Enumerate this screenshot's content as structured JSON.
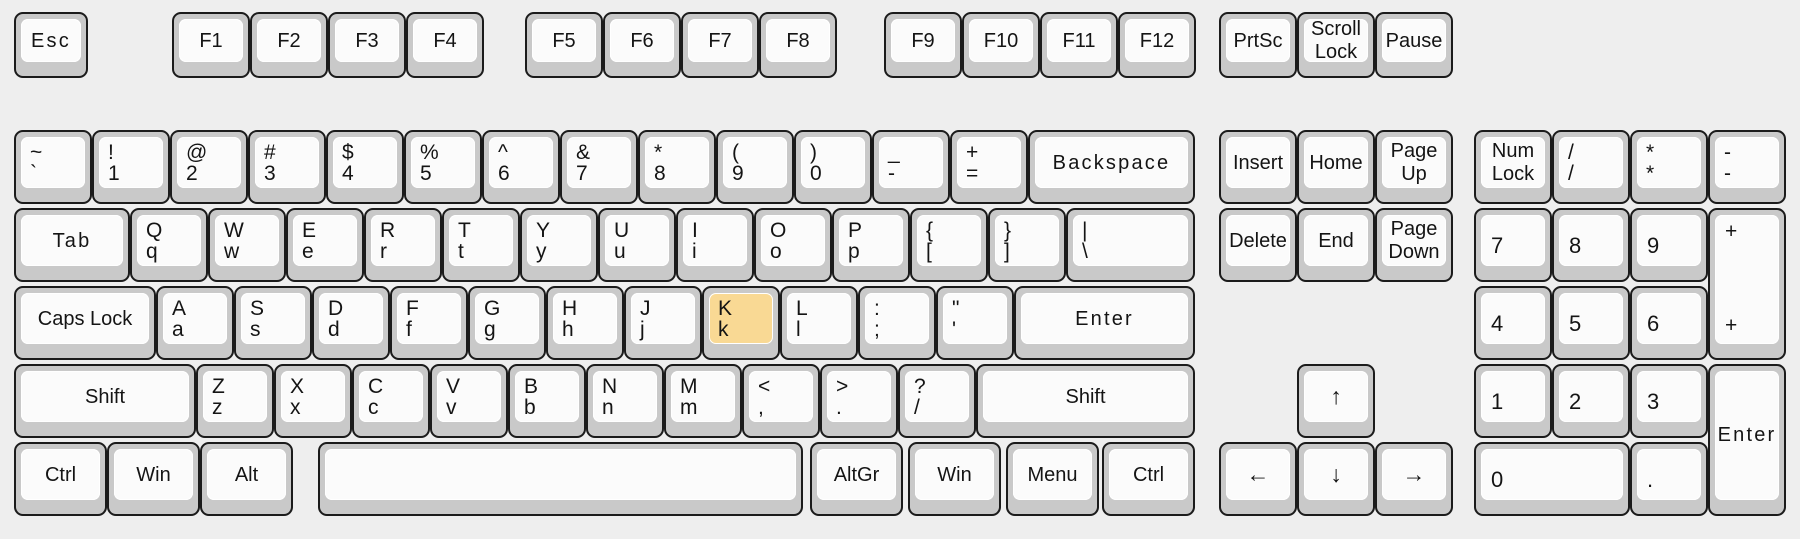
{
  "meta": {
    "title": "Keyboard Layout Diagram",
    "highlight_color": "#f9d994",
    "key_face_color": "#fbfbfb",
    "key_body_color": "#c9c9c9",
    "background_color": "#eeeeee",
    "highlighted_keys": [
      "K"
    ]
  },
  "function_row": {
    "esc": {
      "label": "Esc"
    },
    "group1": [
      {
        "label": "F1"
      },
      {
        "label": "F2"
      },
      {
        "label": "F3"
      },
      {
        "label": "F4"
      }
    ],
    "group2": [
      {
        "label": "F5"
      },
      {
        "label": "F6"
      },
      {
        "label": "F7"
      },
      {
        "label": "F8"
      }
    ],
    "group3": [
      {
        "label": "F9"
      },
      {
        "label": "F10"
      },
      {
        "label": "F11"
      },
      {
        "label": "F12"
      }
    ],
    "group4": [
      {
        "label": "PrtSc"
      },
      {
        "line1": "Scroll",
        "line2": "Lock"
      },
      {
        "label": "Pause"
      }
    ]
  },
  "main_rows": {
    "row_digits": [
      {
        "top": "~",
        "bottom": "`"
      },
      {
        "top": "!",
        "bottom": "1"
      },
      {
        "top": "@",
        "bottom": "2"
      },
      {
        "top": "#",
        "bottom": "3"
      },
      {
        "top": "$",
        "bottom": "4"
      },
      {
        "top": "%",
        "bottom": "5"
      },
      {
        "top": "^",
        "bottom": "6"
      },
      {
        "top": "&",
        "bottom": "7"
      },
      {
        "top": "*",
        "bottom": "8"
      },
      {
        "top": "(",
        "bottom": "9"
      },
      {
        "top": ")",
        "bottom": "0"
      },
      {
        "top": "_",
        "bottom": "-"
      },
      {
        "top": "+",
        "bottom": "="
      },
      {
        "label": "Backspace"
      }
    ],
    "row_qwerty": [
      {
        "label": "Tab"
      },
      {
        "top": "Q",
        "bottom": "q"
      },
      {
        "top": "W",
        "bottom": "w"
      },
      {
        "top": "E",
        "bottom": "e"
      },
      {
        "top": "R",
        "bottom": "r"
      },
      {
        "top": "T",
        "bottom": "t"
      },
      {
        "top": "Y",
        "bottom": "y"
      },
      {
        "top": "U",
        "bottom": "u"
      },
      {
        "top": "I",
        "bottom": "i"
      },
      {
        "top": "O",
        "bottom": "o"
      },
      {
        "top": "P",
        "bottom": "p"
      },
      {
        "top": "{",
        "bottom": "["
      },
      {
        "top": "}",
        "bottom": "]"
      },
      {
        "top": "|",
        "bottom": "\\"
      }
    ],
    "row_asdf": [
      {
        "label": "Caps Lock"
      },
      {
        "top": "A",
        "bottom": "a"
      },
      {
        "top": "S",
        "bottom": "s"
      },
      {
        "top": "D",
        "bottom": "d"
      },
      {
        "top": "F",
        "bottom": "f"
      },
      {
        "top": "G",
        "bottom": "g"
      },
      {
        "top": "H",
        "bottom": "h"
      },
      {
        "top": "J",
        "bottom": "j"
      },
      {
        "top": "K",
        "bottom": "k",
        "highlight": true
      },
      {
        "top": "L",
        "bottom": "l"
      },
      {
        "top": ":",
        "bottom": ";"
      },
      {
        "top": "\"",
        "bottom": "'"
      },
      {
        "label": "Enter"
      }
    ],
    "row_zxcv": [
      {
        "label": "Shift"
      },
      {
        "top": "Z",
        "bottom": "z"
      },
      {
        "top": "X",
        "bottom": "x"
      },
      {
        "top": "C",
        "bottom": "c"
      },
      {
        "top": "V",
        "bottom": "v"
      },
      {
        "top": "B",
        "bottom": "b"
      },
      {
        "top": "N",
        "bottom": "n"
      },
      {
        "top": "M",
        "bottom": "m"
      },
      {
        "top": "<",
        "bottom": ","
      },
      {
        "top": ">",
        "bottom": "."
      },
      {
        "top": "?",
        "bottom": "/"
      },
      {
        "label": "Shift"
      }
    ],
    "row_bottom": [
      {
        "label": "Ctrl"
      },
      {
        "label": "Win"
      },
      {
        "label": "Alt"
      },
      {
        "label": ""
      },
      {
        "label": "AltGr"
      },
      {
        "label": "Win"
      },
      {
        "label": "Menu"
      },
      {
        "label": "Ctrl"
      }
    ]
  },
  "nav_cluster": {
    "row1": [
      {
        "label": "Insert"
      },
      {
        "label": "Home"
      },
      {
        "line1": "Page",
        "line2": "Up"
      }
    ],
    "row2": [
      {
        "label": "Delete"
      },
      {
        "label": "End"
      },
      {
        "line1": "Page",
        "line2": "Down"
      }
    ],
    "arrows": {
      "up": {
        "glyph": "↑",
        "name": "arrow-up"
      },
      "left": {
        "glyph": "←",
        "name": "arrow-left"
      },
      "down": {
        "glyph": "↓",
        "name": "arrow-down"
      },
      "right": {
        "glyph": "→",
        "name": "arrow-right"
      }
    }
  },
  "numpad": {
    "row1": [
      {
        "line1": "Num",
        "line2": "Lock"
      },
      {
        "top": "/",
        "bottom": "/"
      },
      {
        "top": "*",
        "bottom": "*"
      },
      {
        "top": "-",
        "bottom": "-"
      }
    ],
    "row2": [
      {
        "label": "7"
      },
      {
        "label": "8"
      },
      {
        "label": "9"
      }
    ],
    "plus": {
      "top": "+",
      "bottom": "+"
    },
    "row3": [
      {
        "label": "4"
      },
      {
        "label": "5"
      },
      {
        "label": "6"
      }
    ],
    "row4": [
      {
        "label": "1"
      },
      {
        "label": "2"
      },
      {
        "label": "3"
      }
    ],
    "enter": {
      "label": "Enter"
    },
    "row5": [
      {
        "label": "0"
      },
      {
        "label": "."
      }
    ]
  }
}
